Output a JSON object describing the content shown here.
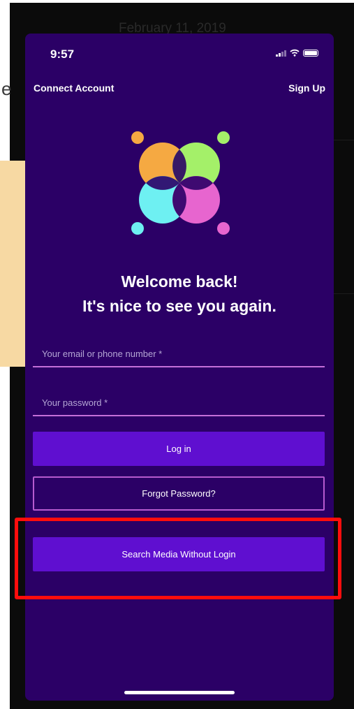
{
  "background": {
    "date_fragment": "February 11, 2019",
    "side_fragment": "e"
  },
  "status_bar": {
    "time": "9:57"
  },
  "nav": {
    "left_label": "Connect Account",
    "right_label": "Sign Up"
  },
  "logo": {
    "icon": "four-circle-logo-icon",
    "colors": [
      "#f5a942",
      "#a4f069",
      "#6ef0f2",
      "#e765cf"
    ]
  },
  "welcome": {
    "line1": "Welcome back!",
    "line2": "It's nice to see you again."
  },
  "form": {
    "email_placeholder": "Your email or phone number *",
    "password_placeholder": "Your password *"
  },
  "buttons": {
    "login_label": "Log in",
    "forgot_label": "Forgot Password?",
    "guest_label": "Search Media Without Login"
  },
  "colors": {
    "screen_bg": "#2b0066",
    "primary_button": "#5f0fd0",
    "outline": "#b75bcf",
    "highlight": "#ff0d0d"
  }
}
